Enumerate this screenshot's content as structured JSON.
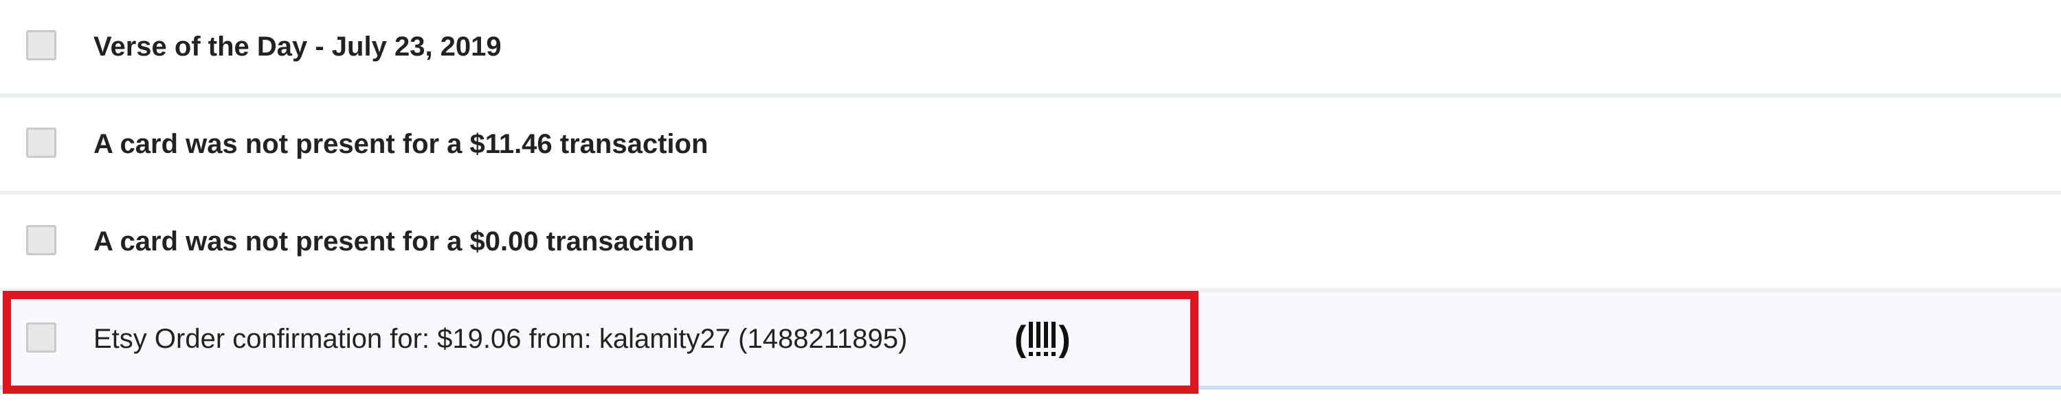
{
  "messages": [
    {
      "subject": "Verse of the Day - July 23, 2019",
      "unread": true
    },
    {
      "subject": "A card was not present for a $11.46 transaction",
      "unread": true
    },
    {
      "subject": "A card was not present for a $0.00 transaction",
      "unread": true
    },
    {
      "subject": "Etsy Order confirmation for: $19.06 from: kalamity27 (1488211895)",
      "unread": false,
      "badge_icon": "exclamation-bars-icon"
    }
  ],
  "colors": {
    "highlight_border": "#e0141c",
    "row_divider": "#eef1f4",
    "selected_row_bg": "#f7f9fc"
  }
}
